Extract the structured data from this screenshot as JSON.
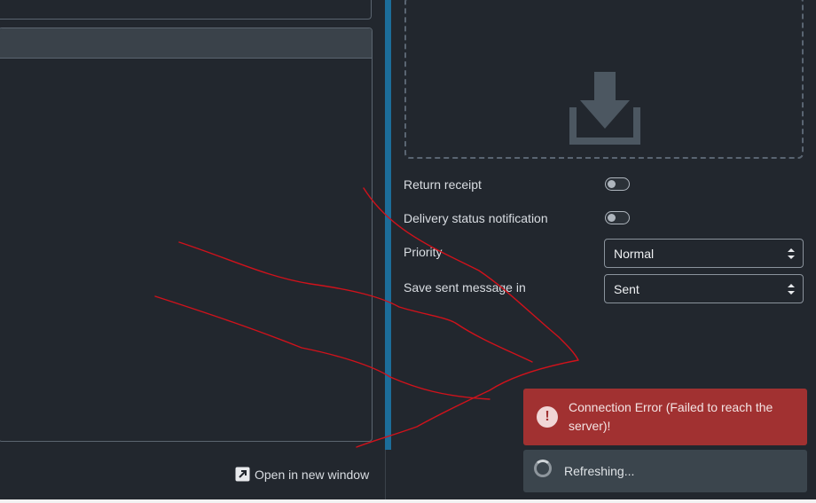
{
  "compose": {
    "open_window_label": "Open in new window",
    "open_window_icon": "external-link-icon"
  },
  "attachments": {
    "icon": "download-icon"
  },
  "options": {
    "return_receipt": {
      "label": "Return receipt",
      "enabled": false
    },
    "delivery_status": {
      "label": "Delivery status notification",
      "enabled": false
    },
    "priority": {
      "label": "Priority",
      "value": "Normal"
    },
    "save_sent": {
      "label": "Save sent message in",
      "value": "Sent"
    }
  },
  "notifications": {
    "error": {
      "message": "Connection Error (Failed to reach the server)!",
      "icon": "exclamation-icon"
    },
    "loading": {
      "message": "Refreshing...",
      "icon": "spinner-icon"
    }
  },
  "colors": {
    "background": "#22272e",
    "splitter": "#1c6d99",
    "error_toast": "#a13131",
    "info_toast": "#3b454d",
    "annotation_stroke": "#d0121b"
  }
}
